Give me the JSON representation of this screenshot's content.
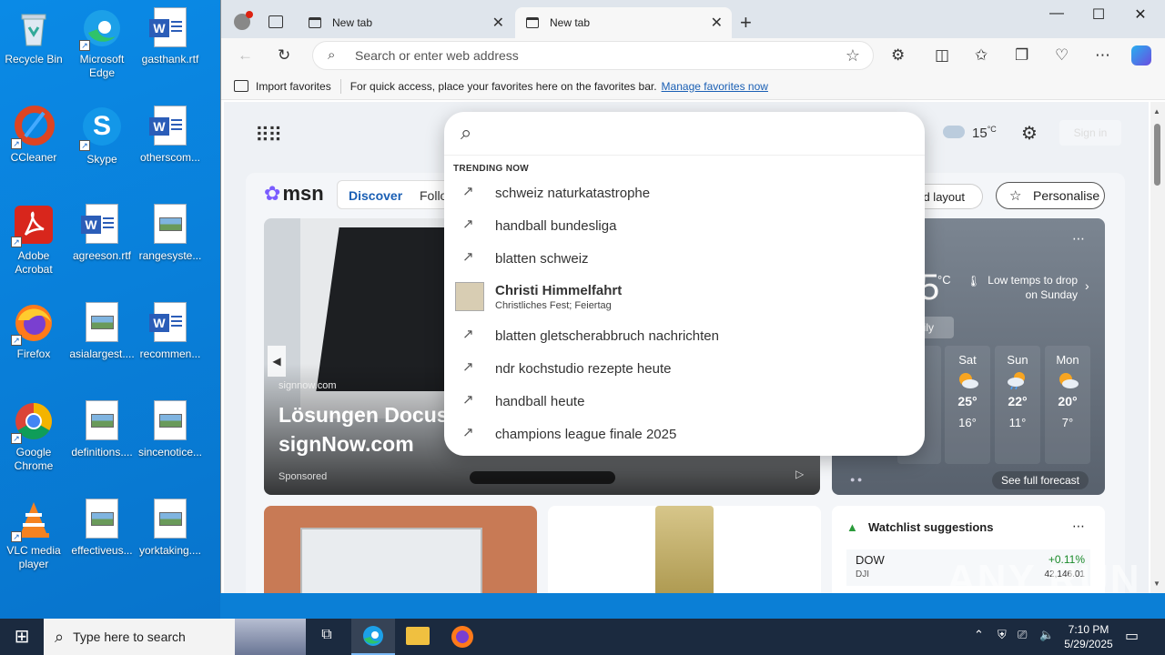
{
  "desktop": {
    "icons": [
      {
        "label": "Recycle Bin"
      },
      {
        "label": "Microsoft Edge"
      },
      {
        "label": "gasthank.rtf"
      },
      {
        "label": "CCleaner"
      },
      {
        "label": "Skype"
      },
      {
        "label": "otherscom..."
      },
      {
        "label": "Adobe Acrobat"
      },
      {
        "label": "agreeson.rtf"
      },
      {
        "label": "rangesyste..."
      },
      {
        "label": "Firefox"
      },
      {
        "label": "asialargest...."
      },
      {
        "label": "recommen..."
      },
      {
        "label": "Google Chrome"
      },
      {
        "label": "definitions...."
      },
      {
        "label": "sincenotice..."
      },
      {
        "label": "VLC media player"
      },
      {
        "label": "effectiveus..."
      },
      {
        "label": "yorktaking...."
      }
    ]
  },
  "browser": {
    "tabs": [
      {
        "label": "New tab"
      },
      {
        "label": "New tab"
      }
    ],
    "address_placeholder": "Search or enter web address",
    "favbar": {
      "import": "Import favorites",
      "hint": "For quick access, place your favorites here on the favorites bar.",
      "manage": "Manage favorites now"
    }
  },
  "newtab": {
    "weather_temp": "15",
    "weather_unit": "°C",
    "signin": "Sign in"
  },
  "msn": {
    "logo": "msn",
    "tabs": {
      "discover": "Discover",
      "following": "Follo"
    },
    "feed_layout": "eed layout",
    "personalise": "Personalise",
    "hero": {
      "source": "signnow.com",
      "title_line1": "Lösungen Docusi",
      "title_line2": "signNow.com",
      "sponsored": "Sponsored"
    }
  },
  "weather_card": {
    "temp_partial": "5",
    "unit": "°C",
    "alert": "Low temps to drop on Sunday",
    "daily_tab": "aily",
    "see_full": "See full forecast",
    "days": [
      {
        "name": "Sat",
        "hi": "25°",
        "lo": "16°"
      },
      {
        "name": "Sun",
        "hi": "22°",
        "lo": "11°"
      },
      {
        "name": "Mon",
        "hi": "20°",
        "lo": "7°"
      }
    ]
  },
  "watchlist": {
    "title": "Watchlist suggestions",
    "ticker": "DOW",
    "sub": "DJI",
    "change": "+0.11%",
    "value": "42,146.01"
  },
  "search_dropdown": {
    "heading": "TRENDING NOW",
    "items": [
      {
        "text": "schweiz naturkatastrophe"
      },
      {
        "text": "handball bundesliga"
      },
      {
        "text": "blatten schweiz"
      },
      {
        "text": "Christi Himmelfahrt",
        "sub": "Christliches Fest; Feiertag"
      },
      {
        "text": "blatten gletscherabbruch nachrichten"
      },
      {
        "text": "ndr kochstudio rezepte heute"
      },
      {
        "text": "handball heute"
      },
      {
        "text": "champions league finale 2025"
      }
    ]
  },
  "taskbar": {
    "search_placeholder": "Type here to search",
    "time": "7:10 PM",
    "date": "5/29/2025"
  },
  "watermark": "ANY RUN"
}
